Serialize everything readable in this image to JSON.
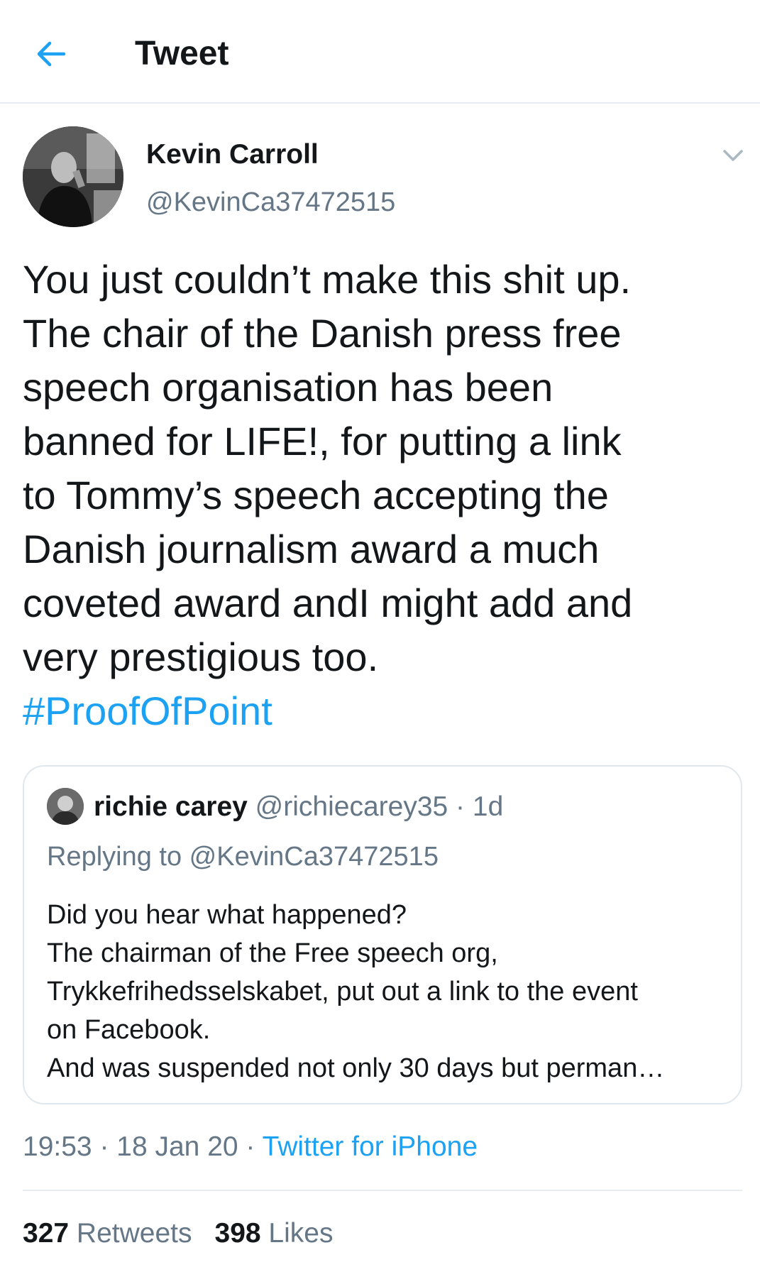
{
  "header": {
    "back_icon": "arrow-left-icon",
    "title": "Tweet"
  },
  "colors": {
    "accent": "#1da1f2",
    "text": "#14171a",
    "secondary": "#657786",
    "border": "#e1e8ed"
  },
  "tweet": {
    "author_name": "Kevin Carroll",
    "author_handle": "@KevinCa37472515",
    "more_icon": "chevron-down-icon",
    "text": "You just couldn’t make this shit up.\nThe chair of the Danish press free\nspeech organisation has been\nbanned for LIFE!, for putting a link\nto Tommy’s speech accepting the\nDanish journalism award a much\ncoveted award andI might add and\nvery prestigious too.",
    "hashtag": "#ProofOfPoint",
    "time": "19:53",
    "sep1": " · ",
    "date": "18 Jan 20",
    "sep2": " · ",
    "source": "Twitter for iPhone",
    "retweets_count": "327",
    "retweets_label": "Retweets",
    "likes_count": "398",
    "likes_label": "Likes"
  },
  "quoted": {
    "name": "richie carey",
    "handle": "@richiecarey35",
    "dot": " · ",
    "time": "1d",
    "replying_to": "Replying to @KevinCa37472515",
    "text": "Did you hear what happened?\nThe chairman of the Free speech org,\nTrykkefrihedsselskabet, put out a link to the event\non Facebook.\nAnd was suspended not only 30 days but perman…"
  }
}
